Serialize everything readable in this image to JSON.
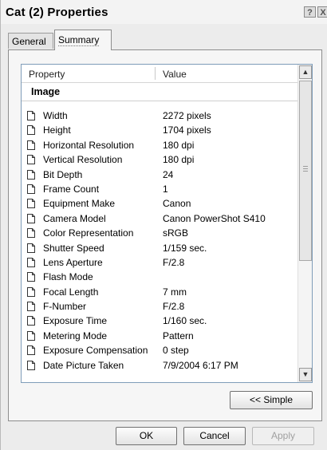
{
  "window": {
    "title": "Cat (2) Properties",
    "help_glyph": "?",
    "close_glyph": "X"
  },
  "tabs": [
    {
      "label": "General",
      "selected": false
    },
    {
      "label": "Summary",
      "selected": true
    }
  ],
  "list": {
    "columns": {
      "property": "Property",
      "value": "Value"
    },
    "group": "Image",
    "rows": [
      {
        "property": "Width",
        "value": "2272 pixels"
      },
      {
        "property": "Height",
        "value": "1704 pixels"
      },
      {
        "property": "Horizontal Resolution",
        "value": "180 dpi"
      },
      {
        "property": "Vertical Resolution",
        "value": "180 dpi"
      },
      {
        "property": "Bit Depth",
        "value": "24"
      },
      {
        "property": "Frame Count",
        "value": "1"
      },
      {
        "property": "Equipment Make",
        "value": "Canon"
      },
      {
        "property": "Camera Model",
        "value": "Canon PowerShot S410"
      },
      {
        "property": "Color Representation",
        "value": "sRGB"
      },
      {
        "property": "Shutter Speed",
        "value": "1/159 sec."
      },
      {
        "property": "Lens Aperture",
        "value": "F/2.8"
      },
      {
        "property": "Flash Mode",
        "value": ""
      },
      {
        "property": "Focal Length",
        "value": "7 mm"
      },
      {
        "property": "F-Number",
        "value": "F/2.8"
      },
      {
        "property": "Exposure Time",
        "value": "1/160 sec."
      },
      {
        "property": "Metering Mode",
        "value": "Pattern"
      },
      {
        "property": "Exposure Compensation",
        "value": "0 step"
      },
      {
        "property": "Date Picture Taken",
        "value": "7/9/2004 6:17 PM"
      }
    ],
    "scroll_up_glyph": "▲",
    "scroll_down_glyph": "▼"
  },
  "buttons": {
    "simple": "<< Simple",
    "ok": "OK",
    "cancel": "Cancel",
    "apply": "Apply"
  },
  "icons": {
    "row_icon": "document-icon"
  }
}
